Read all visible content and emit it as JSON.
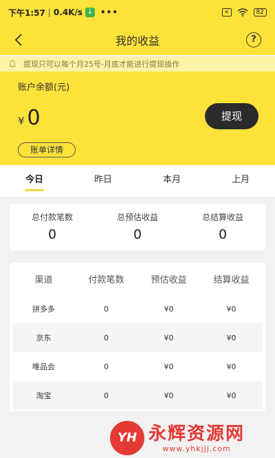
{
  "status_bar": {
    "time": "下午1:57",
    "separator": "|",
    "speed": "0.4K/s",
    "dots": "•••",
    "sim_icon": "sim-off-icon",
    "wifi_icon": "wifi-icon",
    "battery": "82"
  },
  "nav": {
    "back_icon": "chevron-left-icon",
    "title": "我的收益",
    "help_label": "?"
  },
  "notice": {
    "icon": "bell-icon",
    "text": "提现只可以每个月25号-月底才能进行提现操作"
  },
  "balance": {
    "label": "账户余额(元)",
    "currency": "¥",
    "amount": "0",
    "withdraw_label": "提现",
    "bill_label": "账单详情"
  },
  "tabs": [
    {
      "label": "今日",
      "active": true
    },
    {
      "label": "昨日",
      "active": false
    },
    {
      "label": "本月",
      "active": false
    },
    {
      "label": "上月",
      "active": false
    }
  ],
  "summary": [
    {
      "label": "总付款笔数",
      "value": "0"
    },
    {
      "label": "总预估收益",
      "value": "0"
    },
    {
      "label": "总结算收益",
      "value": "0"
    }
  ],
  "channel_table": {
    "headers": [
      "渠道",
      "付款笔数",
      "预估收益",
      "结算收益"
    ],
    "rows": [
      [
        "拼多多",
        "0",
        "¥0",
        "¥0"
      ],
      [
        "京东",
        "0",
        "¥0",
        "¥0"
      ],
      [
        "唯品会",
        "0",
        "¥0",
        "¥0"
      ],
      [
        "淘宝",
        "0",
        "¥0",
        "¥0"
      ]
    ]
  },
  "watermark": {
    "logo_text": "YH",
    "brand": "永辉资源网",
    "url": "www.yhkjjj.com"
  },
  "colors": {
    "accent": "#fde23a",
    "notice_bg": "#fdf3a8",
    "button_dark": "#2b2b2b",
    "watermark_red": "#e53935"
  }
}
